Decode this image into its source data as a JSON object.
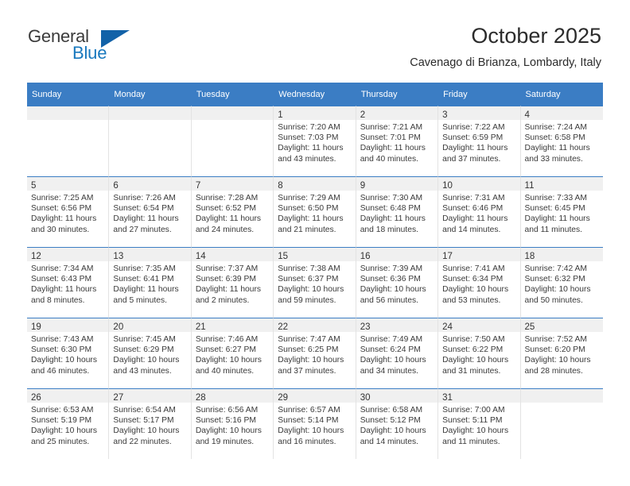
{
  "brand": {
    "name_part1": "General",
    "name_part2": "Blue",
    "accent_color": "#1262a8",
    "blue_text_color": "#1878be"
  },
  "header": {
    "title": "October 2025",
    "subtitle": "Cavenago di Brianza, Lombardy, Italy"
  },
  "calendar": {
    "header_bg": "#3b7dc4",
    "daynum_bg": "#f0f0f0",
    "weekdays": [
      "Sunday",
      "Monday",
      "Tuesday",
      "Wednesday",
      "Thursday",
      "Friday",
      "Saturday"
    ],
    "weeks": [
      [
        {
          "day": ""
        },
        {
          "day": ""
        },
        {
          "day": ""
        },
        {
          "day": "1",
          "sunrise": "Sunrise: 7:20 AM",
          "sunset": "Sunset: 7:03 PM",
          "daylight_line1": "Daylight: 11 hours",
          "daylight_line2": "and 43 minutes."
        },
        {
          "day": "2",
          "sunrise": "Sunrise: 7:21 AM",
          "sunset": "Sunset: 7:01 PM",
          "daylight_line1": "Daylight: 11 hours",
          "daylight_line2": "and 40 minutes."
        },
        {
          "day": "3",
          "sunrise": "Sunrise: 7:22 AM",
          "sunset": "Sunset: 6:59 PM",
          "daylight_line1": "Daylight: 11 hours",
          "daylight_line2": "and 37 minutes."
        },
        {
          "day": "4",
          "sunrise": "Sunrise: 7:24 AM",
          "sunset": "Sunset: 6:58 PM",
          "daylight_line1": "Daylight: 11 hours",
          "daylight_line2": "and 33 minutes."
        }
      ],
      [
        {
          "day": "5",
          "sunrise": "Sunrise: 7:25 AM",
          "sunset": "Sunset: 6:56 PM",
          "daylight_line1": "Daylight: 11 hours",
          "daylight_line2": "and 30 minutes."
        },
        {
          "day": "6",
          "sunrise": "Sunrise: 7:26 AM",
          "sunset": "Sunset: 6:54 PM",
          "daylight_line1": "Daylight: 11 hours",
          "daylight_line2": "and 27 minutes."
        },
        {
          "day": "7",
          "sunrise": "Sunrise: 7:28 AM",
          "sunset": "Sunset: 6:52 PM",
          "daylight_line1": "Daylight: 11 hours",
          "daylight_line2": "and 24 minutes."
        },
        {
          "day": "8",
          "sunrise": "Sunrise: 7:29 AM",
          "sunset": "Sunset: 6:50 PM",
          "daylight_line1": "Daylight: 11 hours",
          "daylight_line2": "and 21 minutes."
        },
        {
          "day": "9",
          "sunrise": "Sunrise: 7:30 AM",
          "sunset": "Sunset: 6:48 PM",
          "daylight_line1": "Daylight: 11 hours",
          "daylight_line2": "and 18 minutes."
        },
        {
          "day": "10",
          "sunrise": "Sunrise: 7:31 AM",
          "sunset": "Sunset: 6:46 PM",
          "daylight_line1": "Daylight: 11 hours",
          "daylight_line2": "and 14 minutes."
        },
        {
          "day": "11",
          "sunrise": "Sunrise: 7:33 AM",
          "sunset": "Sunset: 6:45 PM",
          "daylight_line1": "Daylight: 11 hours",
          "daylight_line2": "and 11 minutes."
        }
      ],
      [
        {
          "day": "12",
          "sunrise": "Sunrise: 7:34 AM",
          "sunset": "Sunset: 6:43 PM",
          "daylight_line1": "Daylight: 11 hours",
          "daylight_line2": "and 8 minutes."
        },
        {
          "day": "13",
          "sunrise": "Sunrise: 7:35 AM",
          "sunset": "Sunset: 6:41 PM",
          "daylight_line1": "Daylight: 11 hours",
          "daylight_line2": "and 5 minutes."
        },
        {
          "day": "14",
          "sunrise": "Sunrise: 7:37 AM",
          "sunset": "Sunset: 6:39 PM",
          "daylight_line1": "Daylight: 11 hours",
          "daylight_line2": "and 2 minutes."
        },
        {
          "day": "15",
          "sunrise": "Sunrise: 7:38 AM",
          "sunset": "Sunset: 6:37 PM",
          "daylight_line1": "Daylight: 10 hours",
          "daylight_line2": "and 59 minutes."
        },
        {
          "day": "16",
          "sunrise": "Sunrise: 7:39 AM",
          "sunset": "Sunset: 6:36 PM",
          "daylight_line1": "Daylight: 10 hours",
          "daylight_line2": "and 56 minutes."
        },
        {
          "day": "17",
          "sunrise": "Sunrise: 7:41 AM",
          "sunset": "Sunset: 6:34 PM",
          "daylight_line1": "Daylight: 10 hours",
          "daylight_line2": "and 53 minutes."
        },
        {
          "day": "18",
          "sunrise": "Sunrise: 7:42 AM",
          "sunset": "Sunset: 6:32 PM",
          "daylight_line1": "Daylight: 10 hours",
          "daylight_line2": "and 50 minutes."
        }
      ],
      [
        {
          "day": "19",
          "sunrise": "Sunrise: 7:43 AM",
          "sunset": "Sunset: 6:30 PM",
          "daylight_line1": "Daylight: 10 hours",
          "daylight_line2": "and 46 minutes."
        },
        {
          "day": "20",
          "sunrise": "Sunrise: 7:45 AM",
          "sunset": "Sunset: 6:29 PM",
          "daylight_line1": "Daylight: 10 hours",
          "daylight_line2": "and 43 minutes."
        },
        {
          "day": "21",
          "sunrise": "Sunrise: 7:46 AM",
          "sunset": "Sunset: 6:27 PM",
          "daylight_line1": "Daylight: 10 hours",
          "daylight_line2": "and 40 minutes."
        },
        {
          "day": "22",
          "sunrise": "Sunrise: 7:47 AM",
          "sunset": "Sunset: 6:25 PM",
          "daylight_line1": "Daylight: 10 hours",
          "daylight_line2": "and 37 minutes."
        },
        {
          "day": "23",
          "sunrise": "Sunrise: 7:49 AM",
          "sunset": "Sunset: 6:24 PM",
          "daylight_line1": "Daylight: 10 hours",
          "daylight_line2": "and 34 minutes."
        },
        {
          "day": "24",
          "sunrise": "Sunrise: 7:50 AM",
          "sunset": "Sunset: 6:22 PM",
          "daylight_line1": "Daylight: 10 hours",
          "daylight_line2": "and 31 minutes."
        },
        {
          "day": "25",
          "sunrise": "Sunrise: 7:52 AM",
          "sunset": "Sunset: 6:20 PM",
          "daylight_line1": "Daylight: 10 hours",
          "daylight_line2": "and 28 minutes."
        }
      ],
      [
        {
          "day": "26",
          "sunrise": "Sunrise: 6:53 AM",
          "sunset": "Sunset: 5:19 PM",
          "daylight_line1": "Daylight: 10 hours",
          "daylight_line2": "and 25 minutes."
        },
        {
          "day": "27",
          "sunrise": "Sunrise: 6:54 AM",
          "sunset": "Sunset: 5:17 PM",
          "daylight_line1": "Daylight: 10 hours",
          "daylight_line2": "and 22 minutes."
        },
        {
          "day": "28",
          "sunrise": "Sunrise: 6:56 AM",
          "sunset": "Sunset: 5:16 PM",
          "daylight_line1": "Daylight: 10 hours",
          "daylight_line2": "and 19 minutes."
        },
        {
          "day": "29",
          "sunrise": "Sunrise: 6:57 AM",
          "sunset": "Sunset: 5:14 PM",
          "daylight_line1": "Daylight: 10 hours",
          "daylight_line2": "and 16 minutes."
        },
        {
          "day": "30",
          "sunrise": "Sunrise: 6:58 AM",
          "sunset": "Sunset: 5:12 PM",
          "daylight_line1": "Daylight: 10 hours",
          "daylight_line2": "and 14 minutes."
        },
        {
          "day": "31",
          "sunrise": "Sunrise: 7:00 AM",
          "sunset": "Sunset: 5:11 PM",
          "daylight_line1": "Daylight: 10 hours",
          "daylight_line2": "and 11 minutes."
        },
        {
          "day": ""
        }
      ]
    ]
  }
}
